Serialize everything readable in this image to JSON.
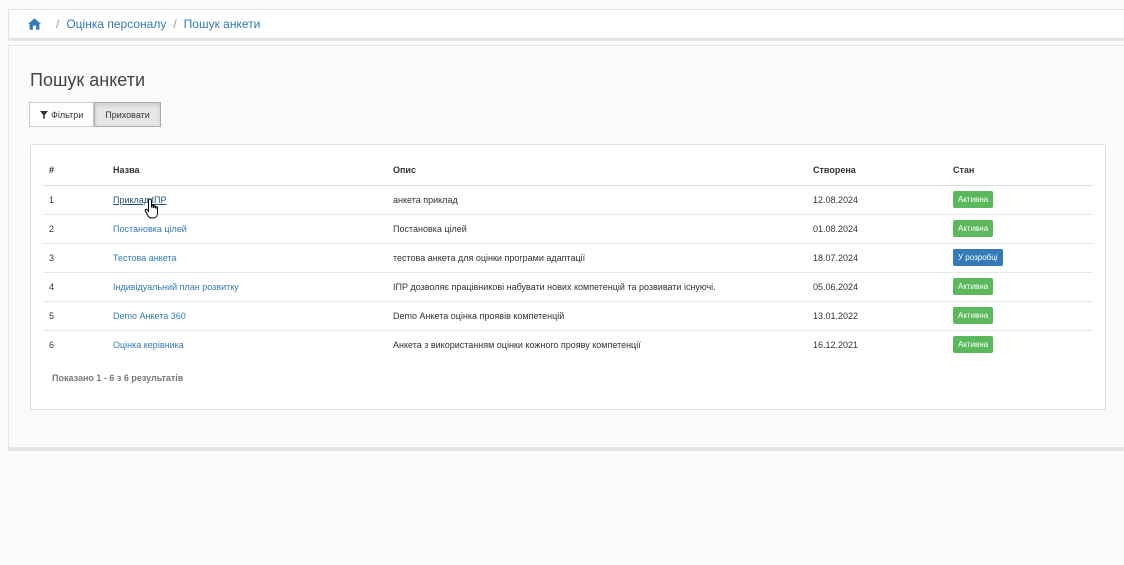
{
  "breadcrumb": {
    "items": [
      "Оцінка персоналу",
      "Пошук анкети"
    ]
  },
  "page": {
    "title": "Пошук анкети"
  },
  "toolbar": {
    "filters_label": "Фільтри",
    "hide_label": "Приховати"
  },
  "table": {
    "headers": [
      "#",
      "Назва",
      "Опис",
      "Створена",
      "Стан"
    ],
    "rows": [
      {
        "num": "1",
        "name": "Приклад ІПР",
        "desc": "анкета приклад",
        "created": "12.08.2024",
        "status": "Активна",
        "status_color": "#5cb85c"
      },
      {
        "num": "2",
        "name": "Постановка цілей",
        "desc": "Постановка цілей",
        "created": "01.08.2024",
        "status": "Активна",
        "status_color": "#5cb85c"
      },
      {
        "num": "3",
        "name": "Тестова анкета",
        "desc": "тестова анкета для оцінки програми адаптації",
        "created": "18.07.2024",
        "status": "У розробці",
        "status_color": "#337ab7"
      },
      {
        "num": "4",
        "name": "Індивідуальний план розвитку",
        "desc": "ІПР дозволяє працівникові набувати нових компетенцій та розвивати існуючі.",
        "created": "05.06.2024",
        "status": "Активна",
        "status_color": "#5cb85c"
      },
      {
        "num": "5",
        "name": "Demo Анкета 360",
        "desc": "Demo Анкета оцінка проявів компетенцій",
        "created": "13.01.2022",
        "status": "Активна",
        "status_color": "#5cb85c"
      },
      {
        "num": "6",
        "name": "Оцінка керівника",
        "desc": "Анкета з використанням оцінки кожного прояву компетенції",
        "created": "16.12.2021",
        "status": "Активна",
        "status_color": "#5cb85c"
      }
    ]
  },
  "summary": "Показано 1 - 6 з 6 результатів",
  "colors": {
    "accent": "#337ab7",
    "active": "#5cb85c",
    "in_dev": "#337ab7"
  }
}
